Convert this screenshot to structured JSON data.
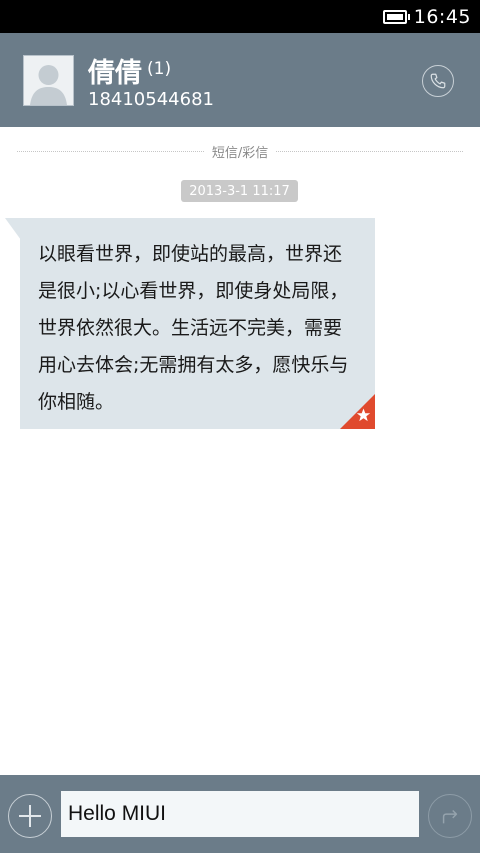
{
  "status_bar": {
    "time": "16:45",
    "battery_icon": "battery-full-icon"
  },
  "header": {
    "contact_name": "倩倩",
    "message_count": "(1)",
    "phone_number": "18410544681",
    "avatar_icon": "default-avatar-icon",
    "call_icon": "phone-icon"
  },
  "conversation": {
    "type_label": "短信/彩信",
    "timestamp": "2013-3-1 11:17",
    "messages": [
      {
        "text": "以眼看世界，即使站的最高，世界还是很小;以心看世界，即使身处局限，世界依然很大。生活远不完美，需要用心去体会;无需拥有太多，愿快乐与你相随。",
        "starred": true
      }
    ]
  },
  "composer": {
    "value": "Hello MIUI",
    "add_icon": "plus-icon",
    "send_icon": "send-icon"
  },
  "colors": {
    "bar": "#6b7c89",
    "bubble": "#dde5ea",
    "star_badge": "#e04a2e"
  }
}
